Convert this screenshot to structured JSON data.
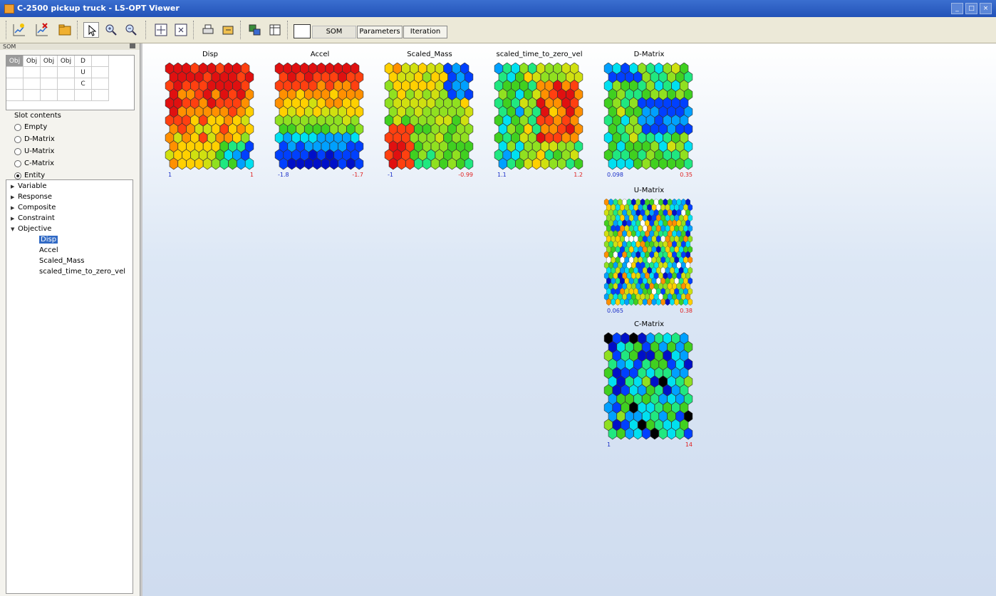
{
  "window": {
    "title": "C-2500 pickup truck - LS-OPT Viewer",
    "controls": [
      "_",
      "□",
      "×"
    ]
  },
  "toolbar": {
    "icons": [
      "new-plot-icon",
      "delete-plot-icon",
      "open-folder-icon",
      "pointer-icon",
      "zoom-in-icon",
      "zoom-out-icon",
      "fit-window-icon",
      "fit-all-icon",
      "print-icon",
      "export-icon",
      "screenshot-icon",
      "columns-icon"
    ],
    "tabs": {
      "som": "SOM",
      "parameters": "Parameters",
      "iteration": "Iteration"
    }
  },
  "left_panel": {
    "header": "SOM",
    "slot_grid": [
      [
        "Obj",
        "Obj",
        "Obj",
        "Obj",
        "D",
        ""
      ],
      [
        "",
        "",
        "",
        "",
        "U",
        ""
      ],
      [
        "",
        "",
        "",
        "",
        "C",
        ""
      ],
      [
        "",
        "",
        "",
        "",
        "",
        ""
      ]
    ],
    "slot_contents_label": "Slot contents",
    "radio_options": [
      "Empty",
      "D-Matrix",
      "U-Matrix",
      "C-Matrix",
      "Entity"
    ],
    "radio_selected": "Entity",
    "tree": [
      {
        "label": "Variable",
        "expanded": false,
        "level": 0
      },
      {
        "label": "Response",
        "expanded": false,
        "level": 0
      },
      {
        "label": "Composite",
        "expanded": false,
        "level": 0
      },
      {
        "label": "Constraint",
        "expanded": false,
        "level": 0
      },
      {
        "label": "Objective",
        "expanded": true,
        "level": 0
      },
      {
        "label": "Disp",
        "level": 1,
        "selected": true
      },
      {
        "label": "Accel",
        "level": 1
      },
      {
        "label": "Scaled_Mass",
        "level": 1
      },
      {
        "label": "scaled_time_to_zero_vel",
        "level": 1
      }
    ]
  },
  "maps": [
    {
      "title": "Disp",
      "min": "1",
      "max": "1",
      "pattern": "disp"
    },
    {
      "title": "Accel",
      "min": "-1.8",
      "max": "-1.7",
      "pattern": "accel"
    },
    {
      "title": "Scaled_Mass",
      "min": "-1",
      "max": "-0.99",
      "pattern": "mass"
    },
    {
      "title": "scaled_time_to_zero_vel",
      "min": "1.1",
      "max": "1.2",
      "pattern": "time"
    },
    {
      "title": "D-Matrix",
      "min": "0.098",
      "max": "0.35",
      "pattern": "dmatrix"
    },
    {
      "title": "U-Matrix",
      "min": "0.065",
      "max": "0.38",
      "pattern": "umatrix"
    },
    {
      "title": "C-Matrix",
      "min": "1",
      "max": "14",
      "pattern": "cmatrix"
    }
  ],
  "colors": {
    "titlebar": "#2a5cc4",
    "selection": "#316ac5",
    "min_label": "#1a2ec8",
    "max_label": "#e02020"
  }
}
